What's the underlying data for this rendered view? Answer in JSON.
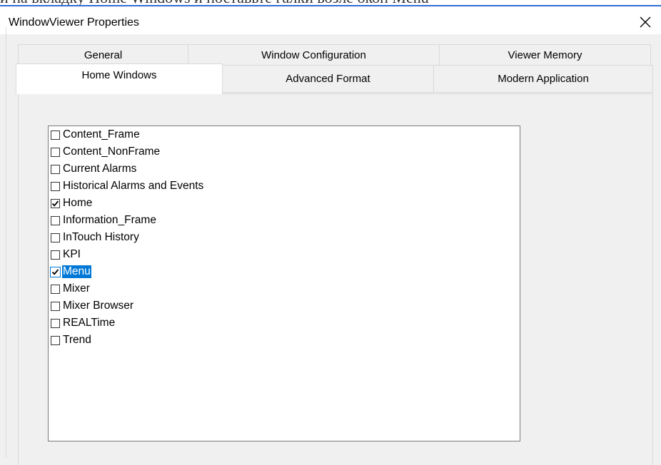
{
  "caption": {
    "text": "и на вкладку Home Windows и поставьте галки возле окон Menu"
  },
  "window": {
    "title": "WindowViewer Properties",
    "close_icon": "close-icon"
  },
  "tabs": {
    "row1": [
      {
        "label": "General"
      },
      {
        "label": "Window Configuration"
      },
      {
        "label": "Viewer Memory"
      }
    ],
    "row2": [
      {
        "label": "Home Windows",
        "active": true
      },
      {
        "label": "Advanced Format"
      },
      {
        "label": "Modern Application"
      }
    ]
  },
  "home_windows": {
    "items": [
      {
        "label": "Content_Frame",
        "checked": false,
        "selected": false
      },
      {
        "label": "Content_NonFrame",
        "checked": false,
        "selected": false
      },
      {
        "label": "Current Alarms",
        "checked": false,
        "selected": false
      },
      {
        "label": "Historical Alarms and Events",
        "checked": false,
        "selected": false
      },
      {
        "label": "Home",
        "checked": true,
        "selected": false
      },
      {
        "label": "Information_Frame",
        "checked": false,
        "selected": false
      },
      {
        "label": "InTouch History",
        "checked": false,
        "selected": false
      },
      {
        "label": "KPI",
        "checked": false,
        "selected": false
      },
      {
        "label": "Menu",
        "checked": true,
        "selected": true
      },
      {
        "label": "Mixer",
        "checked": false,
        "selected": false
      },
      {
        "label": "Mixer Browser",
        "checked": false,
        "selected": false
      },
      {
        "label": "REALTime",
        "checked": false,
        "selected": false
      },
      {
        "label": "Trend",
        "checked": false,
        "selected": false
      }
    ]
  },
  "colors": {
    "selection": "#0078d7",
    "dialog_background": "#f0f0f0",
    "tab_border": "#d9d9d9"
  }
}
